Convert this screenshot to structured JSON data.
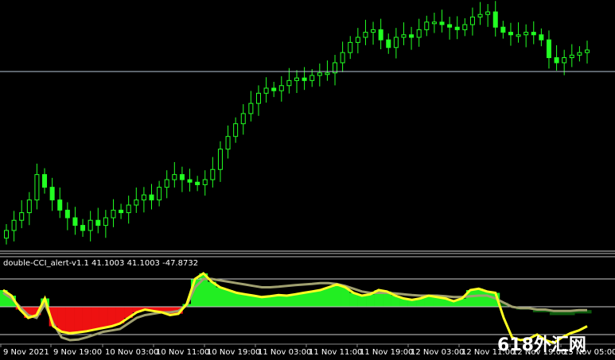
{
  "indicator": {
    "label": "double-CCI_alert-v1.1 41.1003 41.1003 -47.8732"
  },
  "watermark": {
    "text": "618外汇网"
  },
  "colors": {
    "background": "#000000",
    "candle": "#22ff22",
    "hline": "#b9c7d9",
    "hist_pos": "#22ee22",
    "hist_pos_dark": "#0d5a0d",
    "hist_neg": "#ee1111",
    "cci_fast": "#ffff22",
    "cci_slow": "#a0a070",
    "level": "#cccccc",
    "text": "#ffffff"
  },
  "x_axis": {
    "labels": [
      "9 Nov 2021",
      "9 Nov 19:00",
      "10 Nov 03:00",
      "10 Nov 11:00",
      "10 Nov 19:00",
      "11 Nov 03:00",
      "11 Nov 11:00",
      "11 Nov 19:00",
      "12 Nov 03:00",
      "12 Nov 11:00",
      "12 Nov 19:00",
      "15 Nov 05:00"
    ]
  },
  "chart_data": {
    "type": "candlestick",
    "price_panel": {
      "candles_close_relative": [
        0.18,
        0.22,
        0.25,
        0.3,
        0.4,
        0.35,
        0.3,
        0.26,
        0.23,
        0.2,
        0.18,
        0.22,
        0.2,
        0.23,
        0.26,
        0.25,
        0.28,
        0.3,
        0.32,
        0.3,
        0.35,
        0.38,
        0.4,
        0.38,
        0.37,
        0.36,
        0.38,
        0.42,
        0.5,
        0.55,
        0.6,
        0.64,
        0.68,
        0.72,
        0.74,
        0.73,
        0.75,
        0.77,
        0.78,
        0.77,
        0.79,
        0.8,
        0.8,
        0.84,
        0.88,
        0.92,
        0.94,
        0.96,
        0.97,
        0.93,
        0.9,
        0.94,
        0.95,
        0.94,
        0.97,
        1.0,
        1.0,
        0.99,
        0.98,
        0.97,
        0.99,
        1.02,
        1.03,
        1.04,
        0.98,
        0.96,
        0.95,
        0.95,
        0.96,
        0.95,
        0.93,
        0.86,
        0.84,
        0.86,
        0.87,
        0.88,
        0.89
      ]
    },
    "indicator_panel": {
      "series": [
        {
          "name": "CCI fast",
          "values": [
            60,
            40,
            -10,
            -40,
            -30,
            30,
            -70,
            -90,
            -95,
            -92,
            -88,
            -82,
            -76,
            -70,
            -60,
            -40,
            -20,
            -10,
            -15,
            -20,
            -30,
            -25,
            10,
            100,
            120,
            90,
            70,
            60,
            50,
            45,
            40,
            35,
            38,
            42,
            40,
            45,
            50,
            55,
            60,
            70,
            80,
            70,
            50,
            40,
            45,
            60,
            55,
            40,
            30,
            25,
            30,
            40,
            35,
            30,
            20,
            30,
            60,
            65,
            55,
            50,
            -40,
            -110,
            -120,
            -115,
            -100,
            -120,
            -130,
            -110,
            -95,
            -85,
            -70
          ]
        },
        {
          "name": "CCI slow",
          "values": [
            50,
            30,
            0,
            -30,
            -40,
            10,
            -60,
            -110,
            -120,
            -118,
            -110,
            -100,
            -90,
            -85,
            -80,
            -60,
            -40,
            -30,
            -25,
            -20,
            -20,
            -15,
            5,
            70,
            100,
            100,
            95,
            90,
            85,
            80,
            75,
            70,
            70,
            72,
            75,
            78,
            80,
            82,
            85,
            85,
            82,
            75,
            65,
            55,
            50,
            50,
            50,
            48,
            45,
            42,
            40,
            40,
            40,
            38,
            35,
            35,
            38,
            40,
            40,
            30,
            15,
            0,
            -5,
            -5,
            -10,
            -10,
            -15,
            -15,
            -15,
            -12,
            -12
          ]
        }
      ],
      "levels": [
        200,
        100,
        0,
        -100
      ]
    }
  }
}
